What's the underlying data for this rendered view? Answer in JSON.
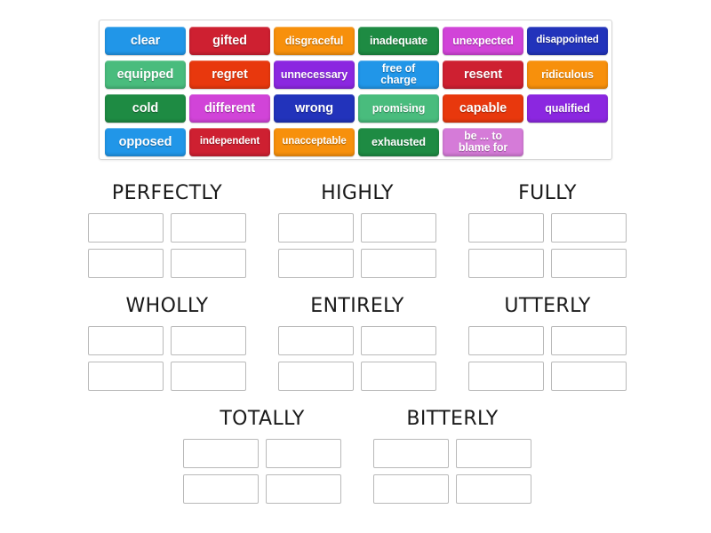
{
  "page": {
    "background": "#ffffff",
    "type": "drag-and-drop word sorting activity"
  },
  "word_bank": {
    "label": "word-bank",
    "rows": [
      [
        {
          "text": "clear",
          "color": "#2196E8",
          "size": "normal"
        },
        {
          "text": "gifted",
          "color": "#CE2031",
          "size": "normal"
        },
        {
          "text": "disgraceful",
          "color": "#F7900C",
          "size": "small"
        },
        {
          "text": "inadequate",
          "color": "#1E8B43",
          "size": "small"
        },
        {
          "text": "unexpected",
          "color": "#D144D8",
          "size": "small"
        },
        {
          "text": "disappointed",
          "color": "#2233BB",
          "size": "xsmall"
        }
      ],
      [
        {
          "text": "equipped",
          "color": "#49BC7D",
          "size": "normal"
        },
        {
          "text": "regret",
          "color": "#E8380D",
          "size": "normal"
        },
        {
          "text": "unnecessary",
          "color": "#8B27E0",
          "size": "small"
        },
        {
          "text": "free of\ncharge",
          "color": "#2196E8",
          "size": "two-line"
        },
        {
          "text": "resent",
          "color": "#CE2031",
          "size": "normal"
        },
        {
          "text": "ridiculous",
          "color": "#F7900C",
          "size": "small"
        }
      ],
      [
        {
          "text": "cold",
          "color": "#1E8B43",
          "size": "normal"
        },
        {
          "text": "different",
          "color": "#D144D8",
          "size": "normal"
        },
        {
          "text": "wrong",
          "color": "#2233BB",
          "size": "normal"
        },
        {
          "text": "promising",
          "color": "#49BC7D",
          "size": "small"
        },
        {
          "text": "capable",
          "color": "#E8380D",
          "size": "normal"
        },
        {
          "text": "qualified",
          "color": "#8B27E0",
          "size": "small"
        }
      ],
      [
        {
          "text": "opposed",
          "color": "#2196E8",
          "size": "normal"
        },
        {
          "text": "independent",
          "color": "#CE2031",
          "size": "xsmall"
        },
        {
          "text": "unacceptable",
          "color": "#F7900C",
          "size": "xsmall"
        },
        {
          "text": "exhausted",
          "color": "#1E8B43",
          "size": "small"
        },
        {
          "text": "be ... to\nblame for",
          "color": "#D57BD8",
          "size": "two-line"
        }
      ]
    ]
  },
  "categories": [
    {
      "title": "PERFECTLY",
      "slots": 4
    },
    {
      "title": "HIGHLY",
      "slots": 4
    },
    {
      "title": "FULLY",
      "slots": 4
    },
    {
      "title": "WHOLLY",
      "slots": 4
    },
    {
      "title": "ENTIRELY",
      "slots": 4
    },
    {
      "title": "UTTERLY",
      "slots": 4
    },
    {
      "title": "TOTALLY",
      "slots": 4
    },
    {
      "title": "BITTERLY",
      "slots": 4
    }
  ]
}
